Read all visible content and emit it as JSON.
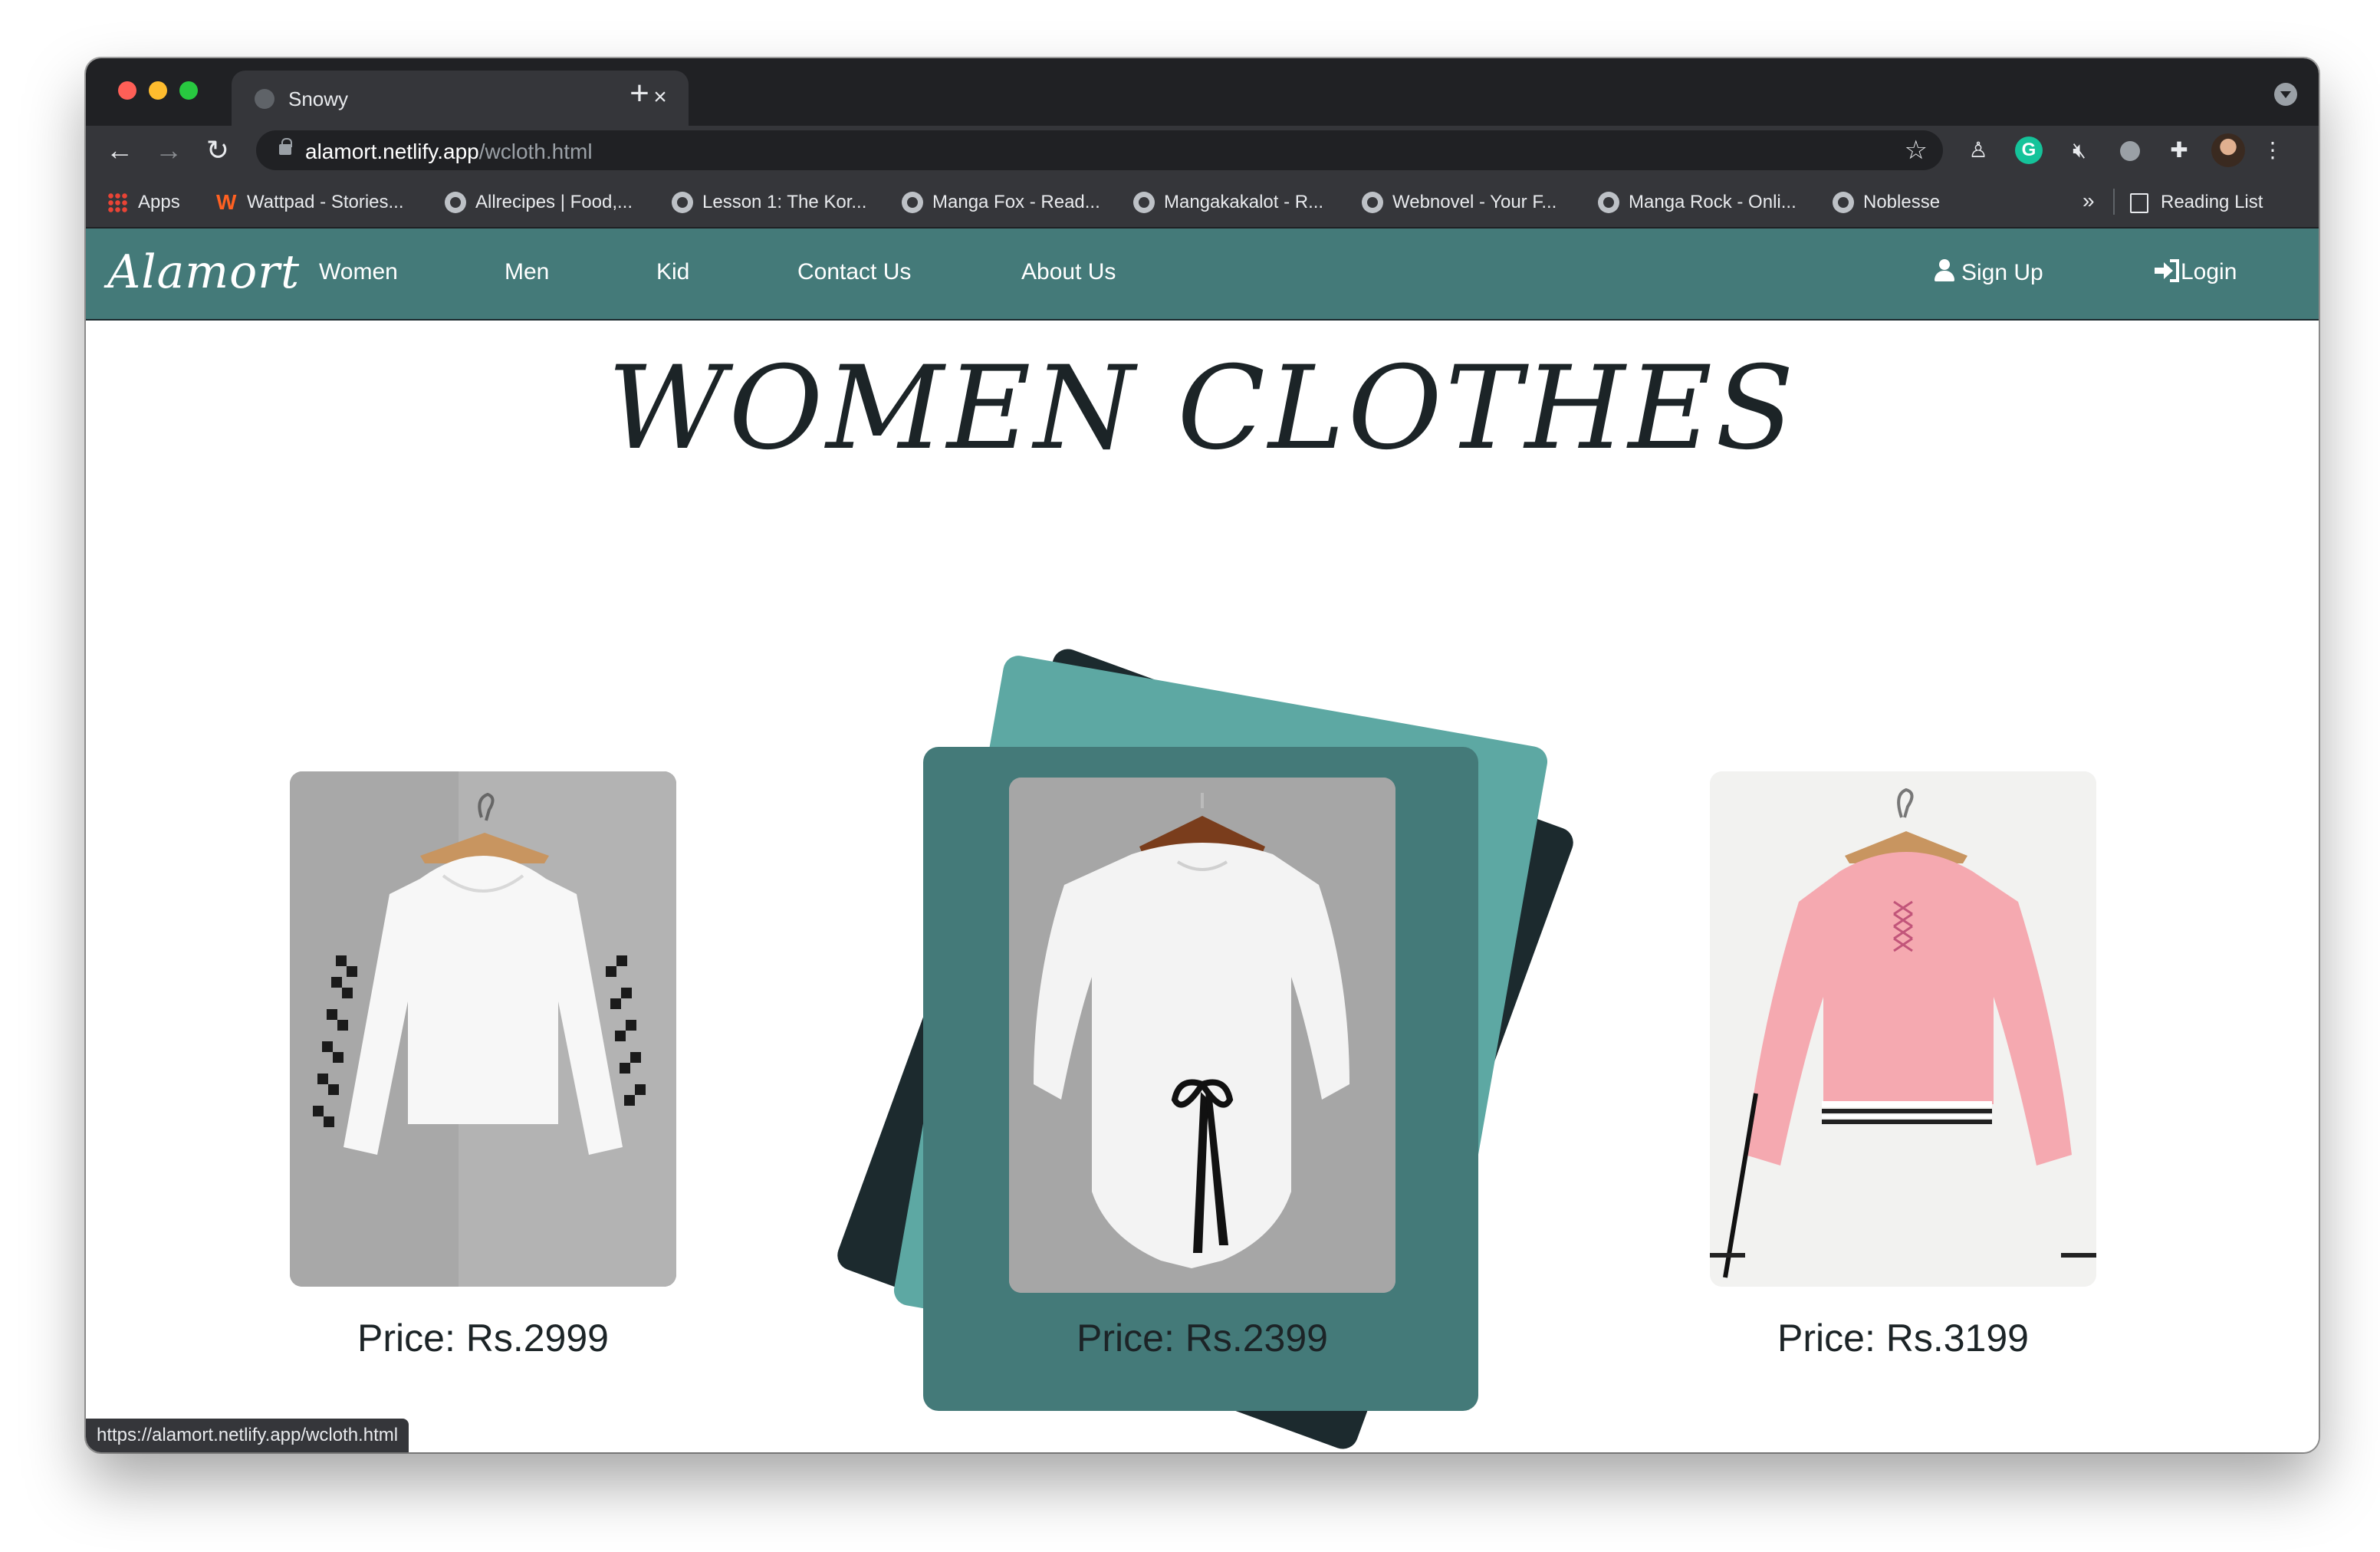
{
  "browser": {
    "tab_title": "Snowy",
    "tab_close": "×",
    "new_tab": "+",
    "url_host": "alamort.netlify.app",
    "url_path": "/wcloth.html",
    "back": "←",
    "forward": "→",
    "reload": "↻",
    "bookmarks": [
      {
        "label": "Apps"
      },
      {
        "label": "Wattpad - Stories..."
      },
      {
        "label": "Allrecipes | Food,..."
      },
      {
        "label": "Lesson 1: The Kor..."
      },
      {
        "label": "Manga Fox - Read..."
      },
      {
        "label": "Mangakakalot - R..."
      },
      {
        "label": "Webnovel - Your F..."
      },
      {
        "label": "Manga Rock - Onli..."
      },
      {
        "label": "Noblesse"
      }
    ],
    "bookmarks_more": "»",
    "reading_list": "Reading List",
    "status_url": "https://alamort.netlify.app/wcloth.html"
  },
  "site": {
    "logo": "Alamort",
    "nav": [
      "Women",
      "Men",
      "Kid",
      "Contact Us",
      "About Us"
    ],
    "sign_up": "Sign Up",
    "login": "Login",
    "page_title": "WOMEN CLOTHES",
    "colors": {
      "nav": "#447a79",
      "teal": "#5da8a3",
      "dark": "#1c2a2e"
    }
  },
  "products": [
    {
      "price": "Price: Rs.2999",
      "image": "white cropped hoodie with checkered sleeves"
    },
    {
      "price": "Price: Rs.2399",
      "image": "white blouse with black tie"
    },
    {
      "price": "Price: Rs.3199",
      "image": "pink lace-up cropped hoodie"
    }
  ]
}
